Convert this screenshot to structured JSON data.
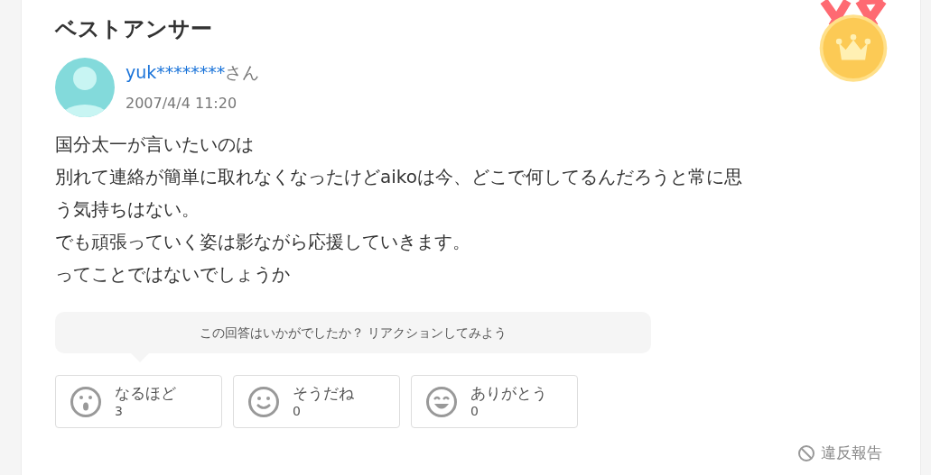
{
  "heading": "ベストアンサー",
  "author": {
    "name": "yuk********",
    "suffix": "さん",
    "date": "2007/4/4 11:20"
  },
  "body_lines": [
    "国分太一が言いたいのは",
    "別れて連絡が簡単に取れなくなったけどaikoは今、どこで何してるんだろうと常に思",
    "う気持ちはない。",
    "でも頑張っていく姿は影ながら応援していきます。",
    "ってことではないでしょうか"
  ],
  "reaction_prompt": "この回答はいかがでしたか？ リアクションしてみよう",
  "reactions": [
    {
      "kind": "surprised",
      "label": "なるほど",
      "count": "3"
    },
    {
      "kind": "smile",
      "label": "そうだね",
      "count": "0"
    },
    {
      "kind": "grin",
      "label": "ありがとう",
      "count": "0"
    }
  ],
  "report_link": "違反報告"
}
